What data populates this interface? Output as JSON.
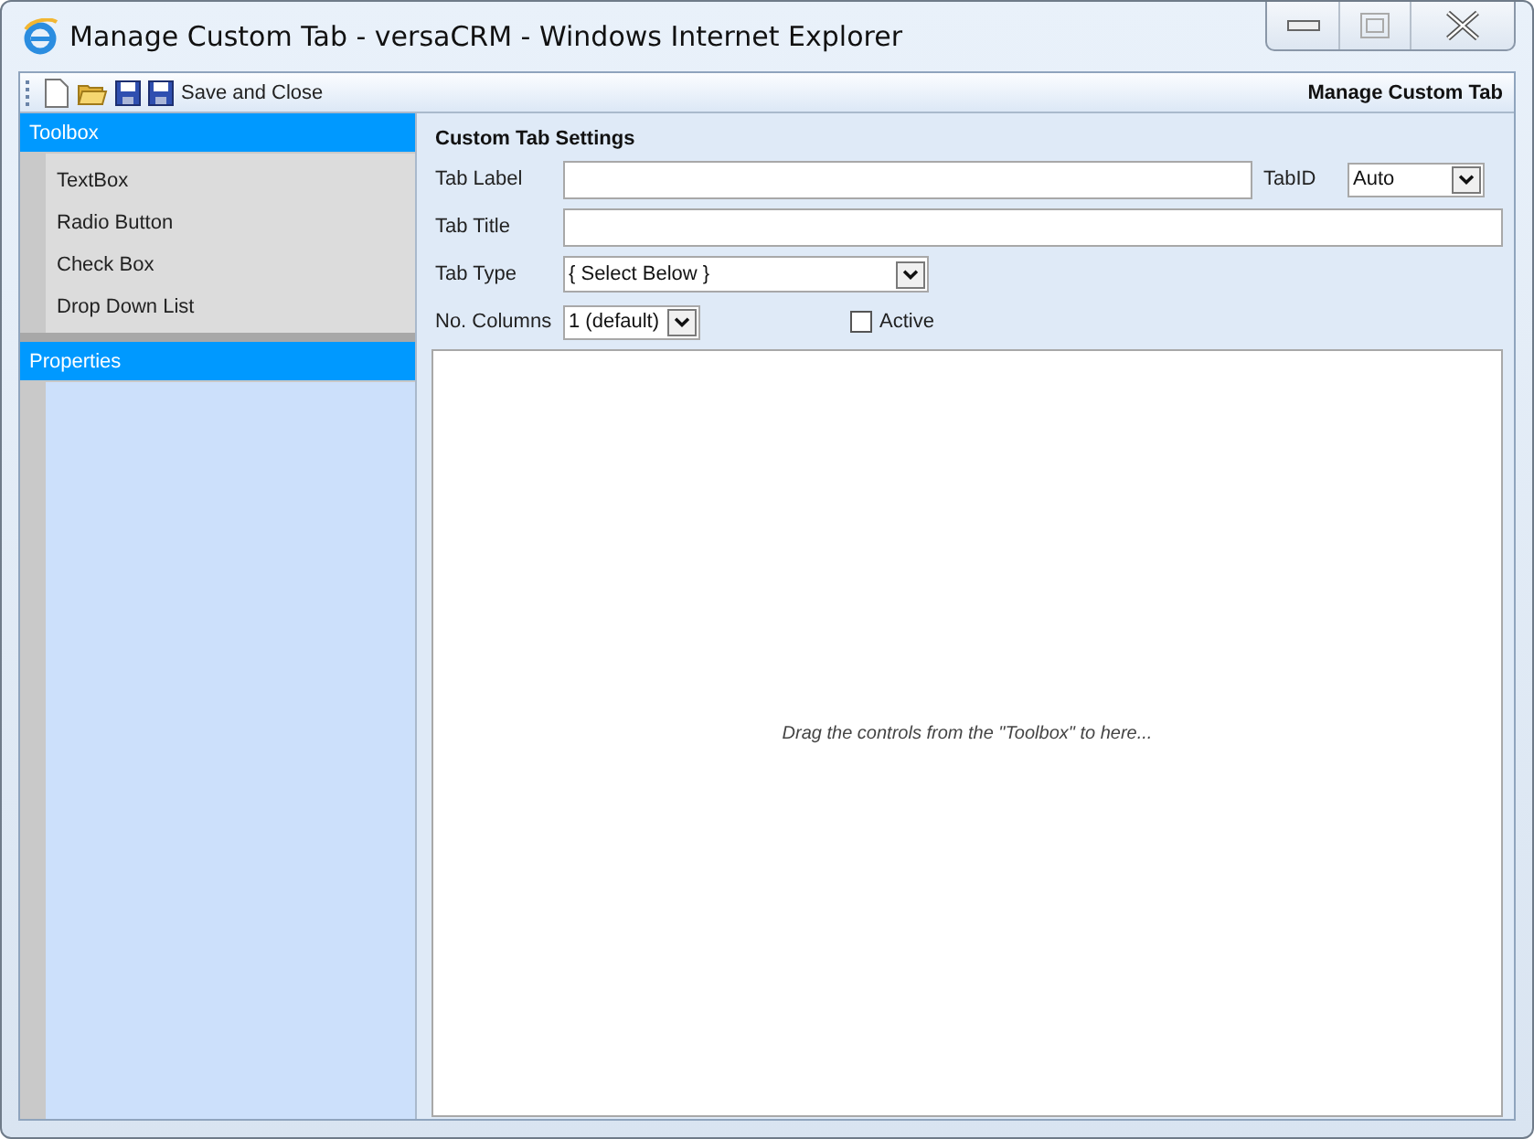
{
  "window": {
    "title": "Manage Custom Tab - versaCRM - Windows Internet Explorer"
  },
  "toolbar": {
    "buttons": [
      {
        "kind": "new"
      },
      {
        "kind": "open"
      },
      {
        "kind": "save"
      },
      {
        "kind": "save",
        "label": "Save and Close"
      }
    ],
    "heading": "Manage Custom Tab"
  },
  "toolbox": {
    "title": "Toolbox",
    "items": [
      "TextBox",
      "Radio Button",
      "Check Box",
      "Drop Down List"
    ]
  },
  "properties": {
    "title": "Properties"
  },
  "settings": {
    "title": "Custom Tab Settings",
    "tab_label": {
      "label": "Tab Label"
    },
    "tab_id": {
      "label": "TabID",
      "value": "Auto"
    },
    "tab_title": {
      "label": "Tab Title"
    },
    "tab_type": {
      "label": "Tab Type",
      "value": "{ Select Below }"
    },
    "columns": {
      "label": "No. Columns",
      "value": "1 (default)"
    },
    "active": {
      "label": "Active",
      "checked": false
    }
  },
  "canvas": {
    "hint": "Drag the controls from the \"Toolbox\" to here..."
  }
}
